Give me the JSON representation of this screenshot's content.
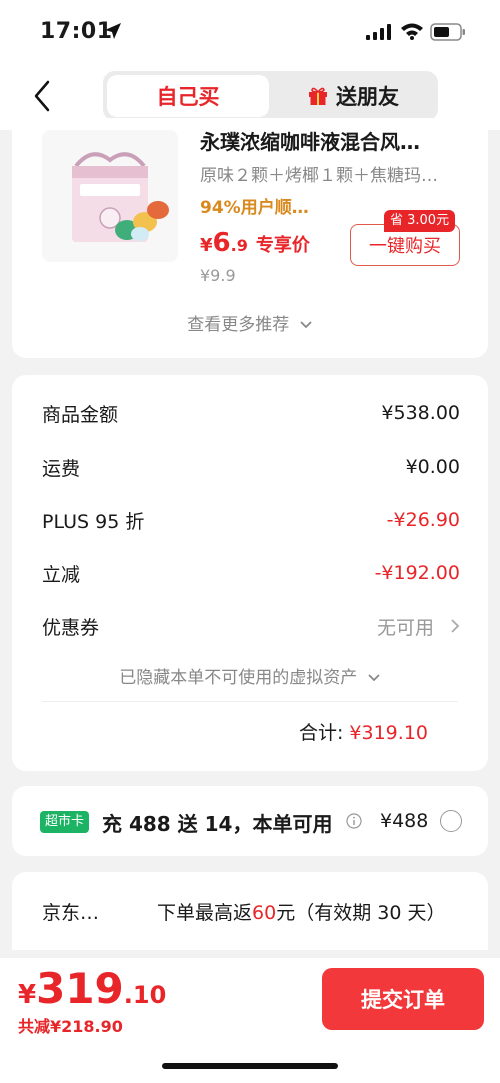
{
  "status_bar": {
    "time": "17:01"
  },
  "header": {
    "tab_self": "自己买",
    "tab_gift": "送朋友"
  },
  "recommend": {
    "title": "永璞浓缩咖啡液混合风…",
    "spec": "原味２颗＋烤椰１颗＋焦糖玛…",
    "rating": "94%用户顺…",
    "price_currency": "¥",
    "price_int": "6",
    "price_dec": ".9",
    "price_tag": "专享价",
    "orig_price": "¥9.9",
    "save_badge": "省 3.00元",
    "buy_button": "一键购买",
    "more": "查看更多推荐"
  },
  "summary": {
    "rows": [
      {
        "label": "商品金额",
        "value": "¥538.00"
      },
      {
        "label": "运费",
        "value": "¥0.00"
      },
      {
        "label": "PLUS 95 折",
        "value": "-¥26.90"
      },
      {
        "label": "立减",
        "value": "-¥192.00"
      },
      {
        "label": "优惠券",
        "value": "无可用"
      }
    ],
    "hidden_assets": "已隐藏本单不可使用的虚拟资产",
    "total_label": "合计:",
    "total_value": "¥319.10"
  },
  "membership": {
    "badge": "超市卡",
    "text": "充 488 送 14，本单可用",
    "price": "¥488"
  },
  "jd": {
    "name": "京东…",
    "desc_pre": "下单最高返",
    "desc_highlight": "60",
    "desc_post": "元（有效期 30 天）"
  },
  "bottom": {
    "currency": "¥",
    "price_int": "319",
    "price_dec": ".10",
    "saved": "共减¥218.90",
    "submit": "提交订单"
  },
  "colors": {
    "accent": "#e8262a",
    "green": "#1db364"
  }
}
